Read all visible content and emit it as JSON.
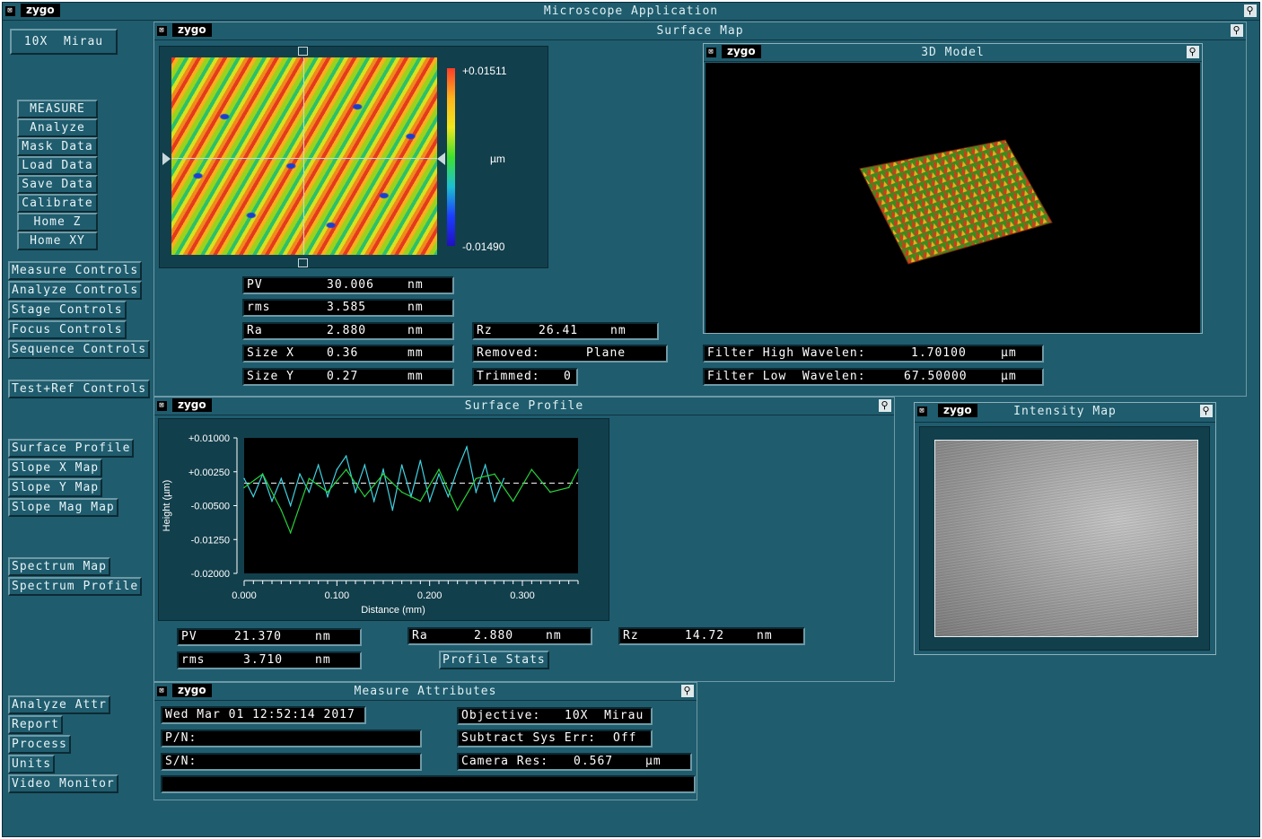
{
  "app": {
    "title": "Microscope Application",
    "logo": "zygo",
    "close_glyph": "⊠"
  },
  "objective_button": "10X  Mirau",
  "left_menu": {
    "group1": [
      "MEASURE",
      "Analyze",
      "Mask Data",
      "Load Data",
      "Save Data",
      "Calibrate",
      "Home Z",
      "Home XY"
    ],
    "group2": [
      "Measure Controls",
      "Analyze Controls",
      "Stage Controls",
      "Focus Controls",
      "Sequence Controls"
    ],
    "group3": [
      "Test+Ref Controls"
    ],
    "group4": [
      "Surface Profile",
      "Slope X Map",
      "Slope Y Map",
      "Slope Mag Map"
    ],
    "group5": [
      "Spectrum Map",
      "Spectrum Profile"
    ],
    "group6": [
      "Analyze Attr",
      "Report",
      "Process",
      "Units",
      "Video Monitor"
    ]
  },
  "surface_map": {
    "title": "Surface Map",
    "scale_max": "+0.01511",
    "scale_min": "-0.01490",
    "scale_unit": "µm",
    "stats": [
      {
        "label": "PV",
        "value": "30.006",
        "unit": "nm"
      },
      {
        "label": "rms",
        "value": "3.585",
        "unit": "nm"
      },
      {
        "label": "Ra",
        "value": "2.880",
        "unit": "nm"
      },
      {
        "label": "Size X",
        "value": "0.36",
        "unit": "mm"
      },
      {
        "label": "Size Y",
        "value": "0.27",
        "unit": "mm"
      }
    ],
    "rz": {
      "label": "Rz",
      "value": "26.41",
      "unit": "nm"
    },
    "removed": {
      "label": "Removed:",
      "value": "Plane"
    },
    "trimmed": {
      "label": "Trimmed:",
      "value": "0"
    }
  },
  "model_3d": {
    "title": "3D Model"
  },
  "filters": {
    "high": {
      "label": "Filter High Wavelen:",
      "value": "1.70100",
      "unit": "µm"
    },
    "low": {
      "label": "Filter Low  Wavelen:",
      "value": "67.50000",
      "unit": "µm"
    }
  },
  "surface_profile": {
    "title": "Surface Profile",
    "pv": {
      "label": "PV",
      "value": "21.370",
      "unit": "nm"
    },
    "rms": {
      "label": "rms",
      "value": "3.710",
      "unit": "nm"
    },
    "ra": {
      "label": "Ra",
      "value": "2.880",
      "unit": "nm"
    },
    "rz": {
      "label": "Rz",
      "value": "14.72",
      "unit": "nm"
    },
    "stats_button": "Profile Stats"
  },
  "intensity_map": {
    "title": "Intensity Map"
  },
  "measure_attributes": {
    "title": "Measure Attributes",
    "datetime": "Wed Mar 01 12:52:14 2017",
    "pn_label": "P/N:",
    "sn_label": "S/N:",
    "objective": {
      "label": "Objective:",
      "value": "10X  Mirau"
    },
    "sys_err": {
      "label": "Subtract Sys Err:",
      "value": "Off"
    },
    "camera": {
      "label": "Camera Res:",
      "value": "0.567",
      "unit": "µm"
    }
  },
  "chart_data": {
    "type": "line",
    "xlabel": "Distance (mm)",
    "ylabel": "Height (µm)",
    "xlim": [
      0,
      0.36
    ],
    "ylim": [
      -0.02,
      0.01
    ],
    "x_ticks": [
      "0.000",
      "0.100",
      "0.200",
      "0.300"
    ],
    "y_ticks": [
      "+0.01000",
      "+0.00250",
      "-0.00500",
      "-0.01250",
      "-0.02000"
    ],
    "reference_line": 0,
    "series": [
      {
        "color": "#3fd2e0",
        "x": [
          0,
          0.01,
          0.02,
          0.03,
          0.04,
          0.05,
          0.06,
          0.07,
          0.08,
          0.09,
          0.1,
          0.11,
          0.12,
          0.13,
          0.14,
          0.15,
          0.16,
          0.17,
          0.18,
          0.19,
          0.2,
          0.21,
          0.22,
          0.23,
          0.24,
          0.25,
          0.26,
          0.27,
          0.28
        ],
        "y": [
          0.001,
          -0.003,
          0.002,
          -0.004,
          0.001,
          -0.005,
          0.002,
          -0.002,
          0.004,
          -0.003,
          0.003,
          0.006,
          -0.002,
          0.004,
          -0.004,
          0.003,
          -0.006,
          0.004,
          -0.003,
          0.005,
          -0.004,
          0.002,
          -0.003,
          0.003,
          0.008,
          -0.002,
          0.004,
          -0.004,
          0.001
        ]
      },
      {
        "color": "#27d23c",
        "x": [
          0,
          0.02,
          0.04,
          0.05,
          0.07,
          0.09,
          0.11,
          0.13,
          0.15,
          0.17,
          0.19,
          0.21,
          0.23,
          0.25,
          0.27,
          0.29,
          0.31,
          0.33,
          0.35,
          0.36
        ],
        "y": [
          -0.001,
          0.002,
          -0.006,
          -0.011,
          0.001,
          -0.002,
          0.003,
          -0.003,
          0.002,
          -0.002,
          -0.004,
          0.003,
          -0.006,
          0.001,
          0.002,
          -0.004,
          0.003,
          -0.002,
          -0.001,
          0.003
        ]
      }
    ]
  }
}
